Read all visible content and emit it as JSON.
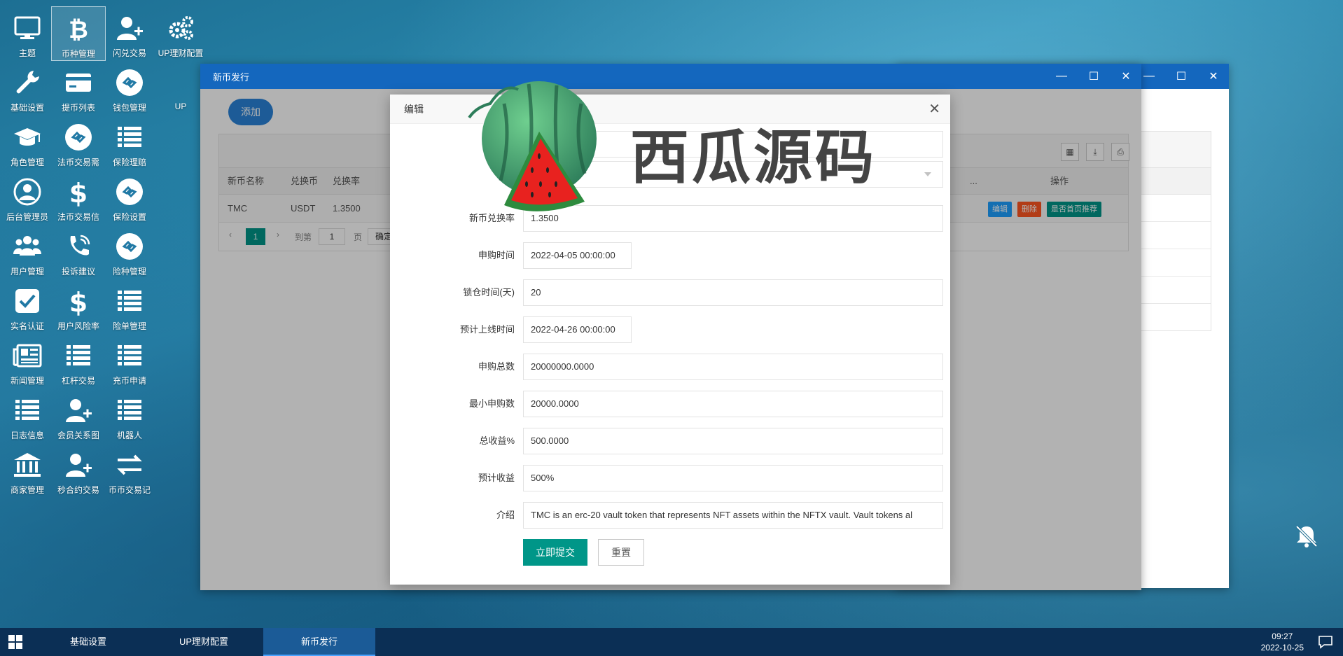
{
  "desktop": {
    "icons": [
      {
        "label": "主题",
        "icon": "monitor-icon"
      },
      {
        "label": "币种管理",
        "icon": "bitcoin-icon"
      },
      {
        "label": "闪兑交易",
        "icon": "add-user-icon"
      },
      {
        "label": "UP理财配置",
        "icon": "gears-icon"
      },
      {
        "label": "基础设置",
        "icon": "wrench-icon"
      },
      {
        "label": "提币列表",
        "icon": "card-icon"
      },
      {
        "label": "钱包管理",
        "icon": "link-circle-icon"
      },
      {
        "label": "UP",
        "icon": "none"
      },
      {
        "label": "角色管理",
        "icon": "graduation-cap-icon"
      },
      {
        "label": "法币交易需",
        "icon": "link-circle-icon"
      },
      {
        "label": "保险理赔",
        "icon": "list-icon"
      },
      {
        "label": "后台管理员",
        "icon": "user-circle-icon"
      },
      {
        "label": "法币交易信",
        "icon": "dollar-icon"
      },
      {
        "label": "保险设置",
        "icon": "link-circle-icon"
      },
      {
        "label": "用户管理",
        "icon": "users-icon"
      },
      {
        "label": "投诉建议",
        "icon": "phone-icon"
      },
      {
        "label": "险种管理",
        "icon": "link-circle-icon"
      },
      {
        "label": "实名认证",
        "icon": "check-square-icon"
      },
      {
        "label": "用户风险率",
        "icon": "dollar-icon"
      },
      {
        "label": "险单管理",
        "icon": "list-icon"
      },
      {
        "label": "新闻管理",
        "icon": "newspaper-icon"
      },
      {
        "label": "杠杆交易",
        "icon": "list-icon"
      },
      {
        "label": "充币申请",
        "icon": "list-icon"
      },
      {
        "label": "日志信息",
        "icon": "list-icon"
      },
      {
        "label": "会员关系图",
        "icon": "add-user-icon"
      },
      {
        "label": "机器人",
        "icon": "list-icon"
      },
      {
        "label": "商家管理",
        "icon": "bank-icon"
      },
      {
        "label": "秒合约交易",
        "icon": "add-user-icon"
      },
      {
        "label": "币币交易记",
        "icon": "exchange-icon"
      }
    ]
  },
  "list_window": {
    "title": "新币发行",
    "add_label": "添加",
    "columns": [
      "新币名称",
      "兑换币",
      "兑换率",
      "...",
      "操作"
    ],
    "row": {
      "name": "TMC",
      "currency": "USDT",
      "rate": "1.3500"
    },
    "actions": {
      "edit": "编辑",
      "delete": "删除",
      "recommend": "是否首页推荐"
    },
    "pager": {
      "page": "1",
      "goto": "到第",
      "page_input": "1",
      "page_unit": "页",
      "confirm": "确定"
    }
  },
  "edit_dialog": {
    "title": "编辑",
    "fields": [
      {
        "label": "新",
        "value": ""
      },
      {
        "label": "币",
        "value": ""
      },
      {
        "label": "新币兑换率",
        "value": "1.3500"
      },
      {
        "label": "申购时间",
        "value": "2022-04-05 00:00:00"
      },
      {
        "label": "锁仓时间(天)",
        "value": "20"
      },
      {
        "label": "预计上线时间",
        "value": "2022-04-26 00:00:00"
      },
      {
        "label": "申购总数",
        "value": "20000000.0000"
      },
      {
        "label": "最小申购数",
        "value": "20000.0000"
      },
      {
        "label": "总收益%",
        "value": "500.0000"
      },
      {
        "label": "预计收益",
        "value": "500%"
      },
      {
        "label": "介绍",
        "value": "TMC is an erc-20 vault token that represents NFT assets within the NFTX vault. Vault tokens al"
      }
    ],
    "submit_label": "立即提交",
    "reset_label": "重置"
  },
  "watermark": {
    "text": "西瓜源码"
  },
  "taskbar": {
    "tasks": [
      "基础设置",
      "UP理财配置",
      "新币发行"
    ],
    "time": "09:27",
    "date": "2022-10-25"
  },
  "colors": {
    "titlebar": "#1467be",
    "primary": "#009688",
    "add": "#2a83d8",
    "edit": "#1e9fff",
    "delete": "#ff5722",
    "taskbar": "#0b2f55"
  }
}
